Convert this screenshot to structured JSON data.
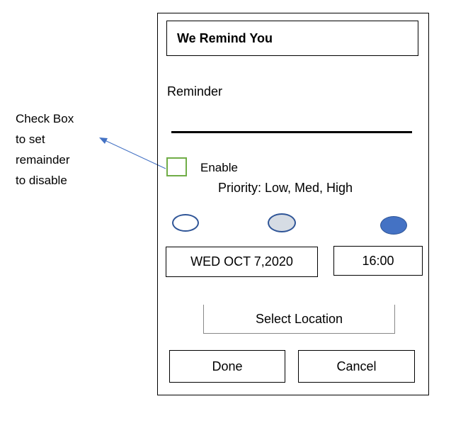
{
  "annotation": {
    "lines": [
      "Check Box",
      "to set",
      "remainder",
      "to disable"
    ],
    "arrow_color": "#4472C4"
  },
  "app": {
    "title": "We Remind You",
    "reminder_label": "Reminder",
    "reminder_value": "",
    "enable_label": "Enable",
    "enable_checked": false,
    "checkbox_color": "#70AD47",
    "priority_label": "Priority: Low, Med, High",
    "priority_options": [
      {
        "level": "Low",
        "fill": "#FFFFFF"
      },
      {
        "level": "Med",
        "fill": "#D6DCE4"
      },
      {
        "level": "High",
        "fill": "#4472C4"
      }
    ],
    "date": "WED OCT 7,2020",
    "time": "16:00",
    "select_location_label": "Select Location",
    "done_label": "Done",
    "cancel_label": "Cancel"
  }
}
